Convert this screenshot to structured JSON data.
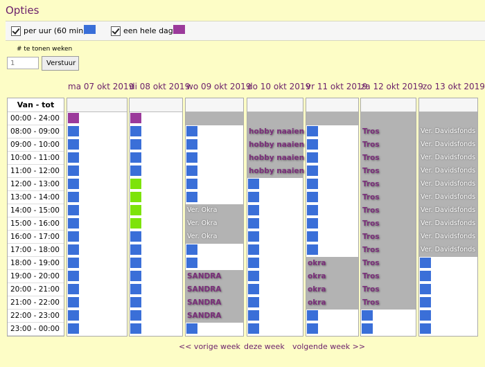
{
  "page_title": "Opties",
  "options": {
    "per_hour_label": "per uur (60 min)",
    "whole_day_label": "een hele dag",
    "colors": {
      "per_hour": "#3a6fd8",
      "whole_day": "#9b3a9b",
      "alt": "#7de30a",
      "busy": "#b3b3b3"
    }
  },
  "weeks": {
    "label": "# te tonen weken",
    "value": "1",
    "button": "Verstuur"
  },
  "time_header": "Van - tot",
  "times": [
    "00:00 - 24:00",
    "08:00 - 09:00",
    "09:00 - 10:00",
    "10:00 - 11:00",
    "11:00 - 12:00",
    "12:00 - 13:00",
    "13:00 - 14:00",
    "14:00 - 15:00",
    "15:00 - 16:00",
    "16:00 - 17:00",
    "17:00 - 18:00",
    "18:00 - 19:00",
    "19:00 - 20:00",
    "20:00 - 21:00",
    "21:00 - 22:00",
    "22:00 - 23:00",
    "23:00 - 00:00"
  ],
  "days": [
    {
      "label": "ma 07 okt 2019",
      "cells": [
        {
          "m": "purple"
        },
        {
          "m": "blue"
        },
        {
          "m": "blue"
        },
        {
          "m": "blue"
        },
        {
          "m": "blue"
        },
        {
          "m": "blue"
        },
        {
          "m": "blue"
        },
        {
          "m": "blue"
        },
        {
          "m": "blue"
        },
        {
          "m": "blue"
        },
        {
          "m": "blue"
        },
        {
          "m": "blue"
        },
        {
          "m": "blue"
        },
        {
          "m": "blue"
        },
        {
          "m": "blue"
        },
        {
          "m": "blue"
        },
        {
          "m": "blue"
        }
      ]
    },
    {
      "label": "di 08 okt 2019",
      "cells": [
        {
          "m": "purple"
        },
        {
          "m": "blue"
        },
        {
          "m": "blue"
        },
        {
          "m": "blue"
        },
        {
          "m": "blue"
        },
        {
          "m": "green"
        },
        {
          "m": "green"
        },
        {
          "m": "green"
        },
        {
          "m": "green"
        },
        {
          "m": "blue"
        },
        {
          "m": "blue"
        },
        {
          "m": "blue"
        },
        {
          "m": "blue"
        },
        {
          "m": "blue"
        },
        {
          "m": "blue"
        },
        {
          "m": "blue"
        },
        {
          "m": "blue"
        }
      ]
    },
    {
      "label": "wo 09 okt 2019",
      "cells": [
        {
          "b": 1
        },
        {
          "m": "blue"
        },
        {
          "m": "blue"
        },
        {
          "m": "blue"
        },
        {
          "m": "blue"
        },
        {
          "m": "blue"
        },
        {
          "m": "blue"
        },
        {
          "b": 1,
          "t": "Ver. Okra",
          "s": "white"
        },
        {
          "b": 1,
          "t": "Ver. Okra",
          "s": "white"
        },
        {
          "b": 1,
          "t": "Ver. Okra",
          "s": "white"
        },
        {
          "m": "blue"
        },
        {
          "m": "blue"
        },
        {
          "b": 1,
          "t": "SANDRA",
          "s": "purple"
        },
        {
          "b": 1,
          "t": "SANDRA",
          "s": "purple"
        },
        {
          "b": 1,
          "t": "SANDRA",
          "s": "purple"
        },
        {
          "b": 1,
          "t": "SANDRA",
          "s": "purple"
        },
        {
          "m": "blue"
        }
      ]
    },
    {
      "label": "do 10 okt 2019",
      "cells": [
        {
          "b": 1
        },
        {
          "b": 1,
          "t": "hobby naaien",
          "s": "purple"
        },
        {
          "b": 1,
          "t": "hobby naaien",
          "s": "purple"
        },
        {
          "b": 1,
          "t": "hobby naaien",
          "s": "purple"
        },
        {
          "b": 1,
          "t": "hobby naaien",
          "s": "purple"
        },
        {
          "m": "blue"
        },
        {
          "m": "blue"
        },
        {
          "m": "blue"
        },
        {
          "m": "blue"
        },
        {
          "m": "blue"
        },
        {
          "m": "blue"
        },
        {
          "m": "blue"
        },
        {
          "m": "blue"
        },
        {
          "m": "blue"
        },
        {
          "m": "blue"
        },
        {
          "m": "blue"
        },
        {
          "m": "blue"
        }
      ]
    },
    {
      "label": "vr 11 okt 2019",
      "cells": [
        {
          "b": 1
        },
        {
          "m": "blue"
        },
        {
          "m": "blue"
        },
        {
          "m": "blue"
        },
        {
          "m": "blue"
        },
        {
          "m": "blue"
        },
        {
          "m": "blue"
        },
        {
          "m": "blue"
        },
        {
          "m": "blue"
        },
        {
          "m": "blue"
        },
        {
          "m": "blue"
        },
        {
          "b": 1,
          "t": "okra",
          "s": "purple"
        },
        {
          "b": 1,
          "t": "okra",
          "s": "purple"
        },
        {
          "b": 1,
          "t": "okra",
          "s": "purple"
        },
        {
          "b": 1,
          "t": "okra",
          "s": "purple"
        },
        {
          "m": "blue"
        },
        {
          "m": "blue"
        }
      ]
    },
    {
      "label": "za 12 okt 2019",
      "cells": [
        {
          "b": 1
        },
        {
          "b": 1,
          "t": "Tros",
          "s": "purple"
        },
        {
          "b": 1,
          "t": "Tros",
          "s": "purple"
        },
        {
          "b": 1,
          "t": "Tros",
          "s": "purple"
        },
        {
          "b": 1,
          "t": "Tros",
          "s": "purple"
        },
        {
          "b": 1,
          "t": "Tros",
          "s": "purple"
        },
        {
          "b": 1,
          "t": "Tros",
          "s": "purple"
        },
        {
          "b": 1,
          "t": "Tros",
          "s": "purple"
        },
        {
          "b": 1,
          "t": "Tros",
          "s": "purple"
        },
        {
          "b": 1,
          "t": "Tros",
          "s": "purple"
        },
        {
          "b": 1,
          "t": "Tros",
          "s": "purple"
        },
        {
          "b": 1,
          "t": "Tros",
          "s": "purple"
        },
        {
          "b": 1,
          "t": "Tros",
          "s": "purple"
        },
        {
          "b": 1,
          "t": "Tros",
          "s": "purple"
        },
        {
          "b": 1,
          "t": "Tros",
          "s": "purple"
        },
        {
          "m": "blue"
        },
        {
          "m": "blue"
        }
      ]
    },
    {
      "label": "zo 13 okt 2019",
      "cells": [
        {
          "b": 1
        },
        {
          "b": 1,
          "t": "Ver. Davidsfonds",
          "s": "white"
        },
        {
          "b": 1,
          "t": "Ver. Davidsfonds",
          "s": "white"
        },
        {
          "b": 1,
          "t": "Ver. Davidsfonds",
          "s": "white"
        },
        {
          "b": 1,
          "t": "Ver. Davidsfonds",
          "s": "white"
        },
        {
          "b": 1,
          "t": "Ver. Davidsfonds",
          "s": "white"
        },
        {
          "b": 1,
          "t": "Ver. Davidsfonds",
          "s": "white"
        },
        {
          "b": 1,
          "t": "Ver. Davidsfonds",
          "s": "white"
        },
        {
          "b": 1,
          "t": "Ver. Davidsfonds",
          "s": "white"
        },
        {
          "b": 1,
          "t": "Ver. Davidsfonds",
          "s": "white"
        },
        {
          "b": 1,
          "t": "Ver. Davidsfonds",
          "s": "white"
        },
        {
          "m": "blue"
        },
        {
          "m": "blue"
        },
        {
          "m": "blue"
        },
        {
          "m": "blue"
        },
        {
          "m": "blue"
        },
        {
          "m": "blue"
        }
      ]
    }
  ],
  "nav": {
    "prev": "<< vorige week",
    "current": "deze week",
    "next": "volgende week >>"
  }
}
